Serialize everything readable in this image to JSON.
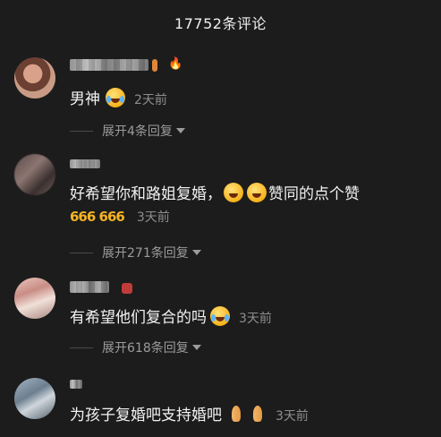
{
  "header": {
    "title": "17752条评论"
  },
  "comments": [
    {
      "text": "男神",
      "time": "2天前",
      "expand_label": "展开4条回复",
      "badge": "🔥"
    },
    {
      "text_before": "好希望你和路姐复婚，",
      "text_after": "赞同的点个赞",
      "sixes": "666 666",
      "time": "3天前",
      "expand_label": "展开271条回复"
    },
    {
      "text": "有希望他们复合的吗",
      "time": "3天前",
      "expand_label": "展开618条回复"
    },
    {
      "text": "为孩子复婚吧支持婚吧",
      "time": "3天前"
    }
  ],
  "icons": {
    "laugh": "laugh-cry-emoji-icon",
    "smile": "blush-emoji-icon",
    "pray": "pray-emoji-icon",
    "caret": "chevron-down-icon"
  }
}
